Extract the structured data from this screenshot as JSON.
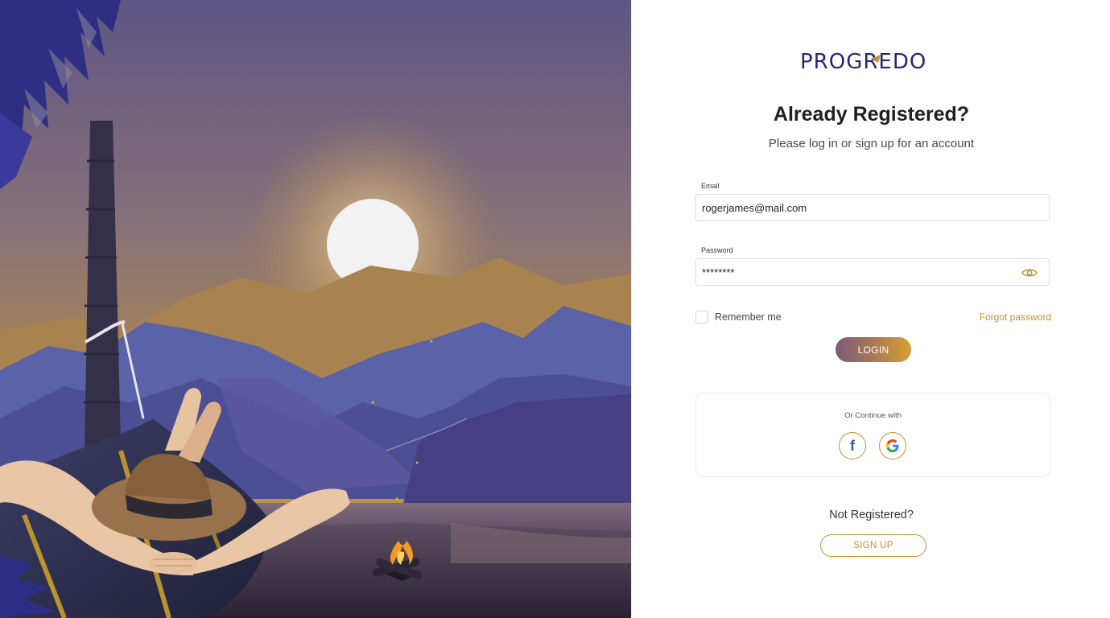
{
  "brand": {
    "logo_text": "PROGREDO",
    "primary_color": "#2b2473",
    "accent_color": "#c4922c"
  },
  "login": {
    "heading": "Already Registered?",
    "subheading": "Please log in or sign up for an account",
    "email_label": "Email",
    "email_value": "rogerjames@mail.com",
    "password_label": "Password",
    "password_value": "********",
    "remember_label": "Remember me",
    "remember_checked": false,
    "forgot_label": "Forgot password",
    "login_button": "LOGIN"
  },
  "social": {
    "title": "Or Continue with",
    "providers": [
      "facebook-icon",
      "google-icon"
    ]
  },
  "signup": {
    "prompt": "Not Registered?",
    "button": "SIGN UP"
  }
}
